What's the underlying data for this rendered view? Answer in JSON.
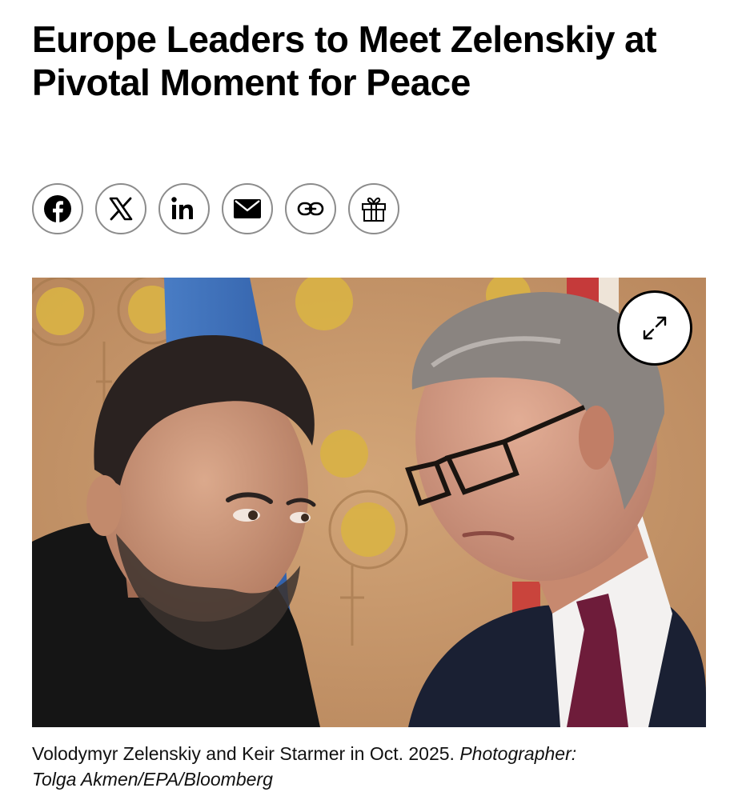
{
  "article": {
    "headline": "Europe Leaders to Meet Zelenskiy at Pivotal Moment for Peace"
  },
  "share": {
    "buttons": [
      {
        "icon": "facebook-icon",
        "label": "Facebook"
      },
      {
        "icon": "x-icon",
        "label": "X"
      },
      {
        "icon": "linkedin-icon",
        "label": "in"
      },
      {
        "icon": "email-icon",
        "label": "Email"
      },
      {
        "icon": "link-icon",
        "label": "Copy link"
      },
      {
        "icon": "gift-icon",
        "label": "Gift"
      }
    ]
  },
  "photo": {
    "expand_icon": "expand-arrows-icon"
  },
  "caption": {
    "text": "Volodymyr Zelenskiy and Keir Starmer in Oct. 2025.",
    "credit_label": "Photographer:",
    "credit": "Tolga Akmen/EPA/Bloomberg"
  },
  "colors": {
    "border": "#8c8c8c",
    "text": "#000000",
    "background": "#ffffff"
  }
}
